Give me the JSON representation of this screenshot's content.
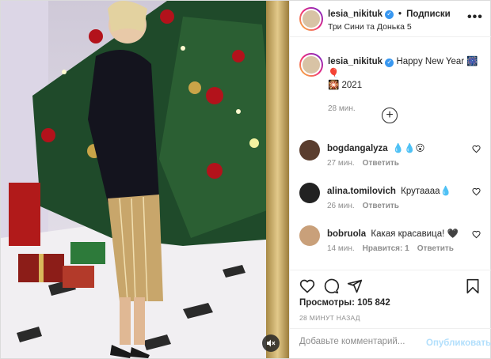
{
  "post": {
    "username": "lesia_nikituk",
    "follow_label": "Подписки",
    "separator": "•",
    "location": "Три Сини та Донька 5",
    "more_label": "•••"
  },
  "caption": {
    "username": "lesia_nikituk",
    "text": "Happy New Year 🎆🎈\n🎇 2021",
    "time": "28 мин."
  },
  "comments": [
    {
      "username": "bogdangalyza",
      "text": "💧💧😮",
      "time": "27 мин.",
      "reply": "Ответить",
      "likes": ""
    },
    {
      "username": "alina.tomilovich",
      "text": "Крутаааа💧",
      "time": "26 мин.",
      "reply": "Ответить",
      "likes": ""
    },
    {
      "username": "bobruola",
      "text": "Какая красавица! 🖤",
      "time": "14 мин.",
      "reply": "Ответить",
      "likes": "Нравится: 1"
    }
  ],
  "stats": {
    "views": "Просмотры: 105 842",
    "ago": "28 МИНУТ НАЗАД"
  },
  "comment_form": {
    "placeholder": "Добавьте комментарий...",
    "publish": "Опубликовать"
  },
  "colors": {
    "accent": "#3897f0",
    "publish_disabled": "#b2dffc",
    "muted": "#8e8e8e"
  }
}
